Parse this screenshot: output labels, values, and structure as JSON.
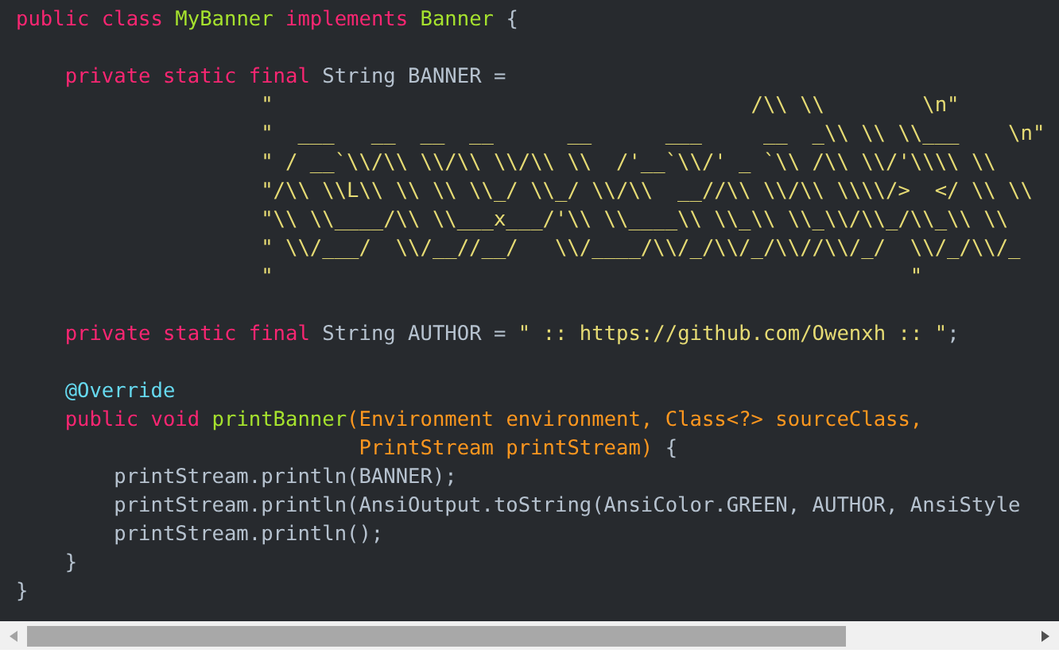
{
  "code_lines": [
    {
      "kind": "code",
      "tokens": [
        {
          "kind": "keyword",
          "text": "public class "
        },
        {
          "kind": "type",
          "text": "MyBanner"
        },
        {
          "kind": "keyword",
          "text": " implements "
        },
        {
          "kind": "type",
          "text": "Banner"
        },
        {
          "kind": "plain",
          "text": " {"
        }
      ]
    },
    {
      "kind": "blank"
    },
    {
      "kind": "code",
      "tokens": [
        {
          "kind": "keyword",
          "text": "    private static final "
        },
        {
          "kind": "plain",
          "text": "String BANNER ="
        }
      ]
    },
    {
      "kind": "code",
      "tokens": [
        {
          "kind": "string",
          "text": "                    \"                                       /\\\\ \\\\        \\n\""
        }
      ]
    },
    {
      "kind": "code",
      "tokens": [
        {
          "kind": "string",
          "text": "                    \"  ___   __  __  __      __      ___     __  _\\\\ \\\\ \\\\___    \\n\""
        }
      ]
    },
    {
      "kind": "code",
      "tokens": [
        {
          "kind": "string",
          "text": "                    \" / __`\\\\/\\\\ \\\\/\\\\ \\\\/\\\\ \\\\  /'__`\\\\/' _ `\\\\ /\\\\ \\\\/'\\\\\\\\ \\\\"
        }
      ]
    },
    {
      "kind": "code",
      "tokens": [
        {
          "kind": "string",
          "text": "                    \"/\\\\ \\\\L\\\\ \\\\ \\\\ \\\\_/ \\\\_/ \\\\/\\\\  __//\\\\ \\\\/\\\\ \\\\\\\\/>  </ \\\\ \\\\"
        }
      ]
    },
    {
      "kind": "code",
      "tokens": [
        {
          "kind": "string",
          "text": "                    \"\\\\ \\\\____/\\\\ \\\\___x___/'\\\\ \\\\____\\\\ \\\\_\\\\ \\\\_\\\\/\\\\_/\\\\_\\\\ \\\\"
        }
      ]
    },
    {
      "kind": "code",
      "tokens": [
        {
          "kind": "string",
          "text": "                    \" \\\\/___/  \\\\/__//__/   \\\\/____/\\\\/_/\\\\/_/\\\\//\\\\/_/  \\\\/_/\\\\/_"
        }
      ]
    },
    {
      "kind": "code",
      "tokens": [
        {
          "kind": "string",
          "text": "                    \"                                                    \""
        }
      ]
    },
    {
      "kind": "blank"
    },
    {
      "kind": "code",
      "tokens": [
        {
          "kind": "keyword",
          "text": "    private static final "
        },
        {
          "kind": "plain",
          "text": "String AUTHOR = "
        },
        {
          "kind": "string",
          "text": "\" :: https://github.com/Owenxh :: \""
        },
        {
          "kind": "plain",
          "text": ";"
        }
      ]
    },
    {
      "kind": "blank"
    },
    {
      "kind": "code",
      "tokens": [
        {
          "kind": "annotation",
          "text": "    @Override"
        }
      ]
    },
    {
      "kind": "code",
      "tokens": [
        {
          "kind": "keyword",
          "text": "    public void "
        },
        {
          "kind": "type",
          "text": "printBanner"
        },
        {
          "kind": "param",
          "text": "(Environment environment, Class<?> sourceClass,"
        }
      ]
    },
    {
      "kind": "code",
      "tokens": [
        {
          "kind": "param",
          "text": "                            PrintStream printStream)"
        },
        {
          "kind": "plain",
          "text": " {"
        }
      ]
    },
    {
      "kind": "code",
      "tokens": [
        {
          "kind": "plain",
          "text": "        printStream.println(BANNER);"
        }
      ]
    },
    {
      "kind": "code",
      "tokens": [
        {
          "kind": "plain",
          "text": "        printStream.println(AnsiOutput.toString(AnsiColor.GREEN, AUTHOR, AnsiStyle"
        }
      ]
    },
    {
      "kind": "code",
      "tokens": [
        {
          "kind": "plain",
          "text": "        printStream.println();"
        }
      ]
    },
    {
      "kind": "code",
      "tokens": [
        {
          "kind": "plain",
          "text": "    }"
        }
      ]
    },
    {
      "kind": "code",
      "tokens": [
        {
          "kind": "plain",
          "text": "}"
        }
      ]
    }
  ]
}
